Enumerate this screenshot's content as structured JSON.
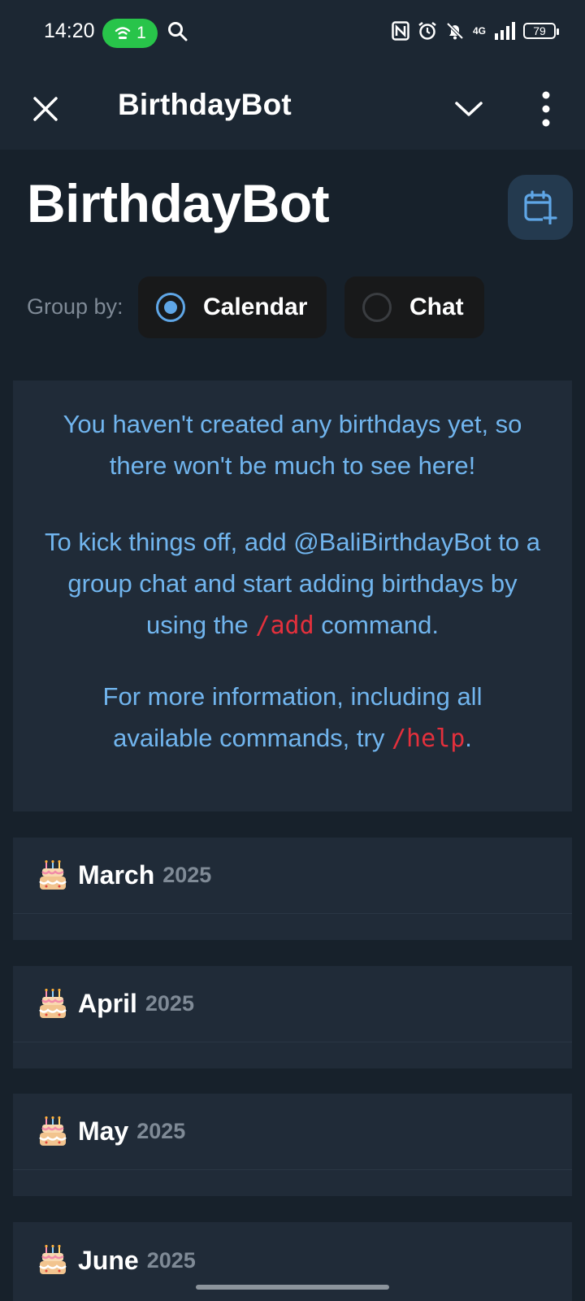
{
  "status_bar": {
    "time": "14:20",
    "hotspot_count": "1",
    "network": "4G",
    "battery": "79"
  },
  "app_bar": {
    "title": "BirthdayBot"
  },
  "page": {
    "title": "BirthdayBot",
    "group_by_label": "Group by:",
    "options": [
      {
        "label": "Calendar",
        "selected": true
      },
      {
        "label": "Chat",
        "selected": false
      }
    ]
  },
  "info": {
    "p1": "You haven't created any birthdays yet, so there won't be much to see here!",
    "p2_before": "To kick things off, add @BaliBirthdayBot to a group chat and start adding birthdays by using the ",
    "p2_cmd": "/add",
    "p2_after": " command.",
    "p3_before": "For more information, including all available commands, try ",
    "p3_cmd": "/help",
    "p3_after": "."
  },
  "months": [
    {
      "name": "March",
      "year": "2025"
    },
    {
      "name": "April",
      "year": "2025"
    },
    {
      "name": "May",
      "year": "2025"
    },
    {
      "name": "June",
      "year": "2025"
    }
  ],
  "colors": {
    "background": "#17212b",
    "card": "#202b38",
    "link_blue": "#71b5ee",
    "command_red": "#e3303c",
    "accent": "#5fa6e6"
  }
}
